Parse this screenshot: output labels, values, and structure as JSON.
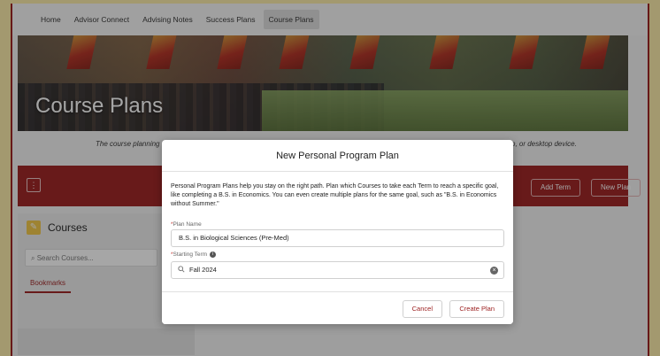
{
  "nav": {
    "items": [
      {
        "label": "Home"
      },
      {
        "label": "Advisor Connect"
      },
      {
        "label": "Advising Notes"
      },
      {
        "label": "Success Plans"
      },
      {
        "label": "Course Plans"
      }
    ],
    "active": "Course Plans"
  },
  "hero": {
    "title": "Course Plans"
  },
  "tagline": {
    "left": "The course planning",
    "right": "p, or desktop device."
  },
  "toolbar": {
    "menu_icon": "⋮",
    "add_term": "Add Term",
    "new_plan": "New Plan"
  },
  "sidebar": {
    "icon": "pencil-icon",
    "title": "Courses",
    "search_placeholder": "Search Courses...",
    "tab": "Bookmarks"
  },
  "modal": {
    "title": "New Personal Program Plan",
    "description": "Personal Program Plans help you stay on the right path. Plan which Courses to take each Term to reach a specific goal, like completing a B.S. in Economics. You can even create multiple plans for the same goal, such as \"B.S. in Economics without Summer.\"",
    "plan_name_label": "Plan Name",
    "plan_name_value": "B.S. in Biological Sciences (Pre-Med)",
    "starting_term_label": "Starting Term",
    "starting_term_value": "Fall 2024",
    "cancel_label": "Cancel",
    "create_label": "Create Plan"
  },
  "colors": {
    "accent": "#9b1d1d",
    "page_bg": "#fbeaa6",
    "icon_yellow": "#f2c744"
  }
}
